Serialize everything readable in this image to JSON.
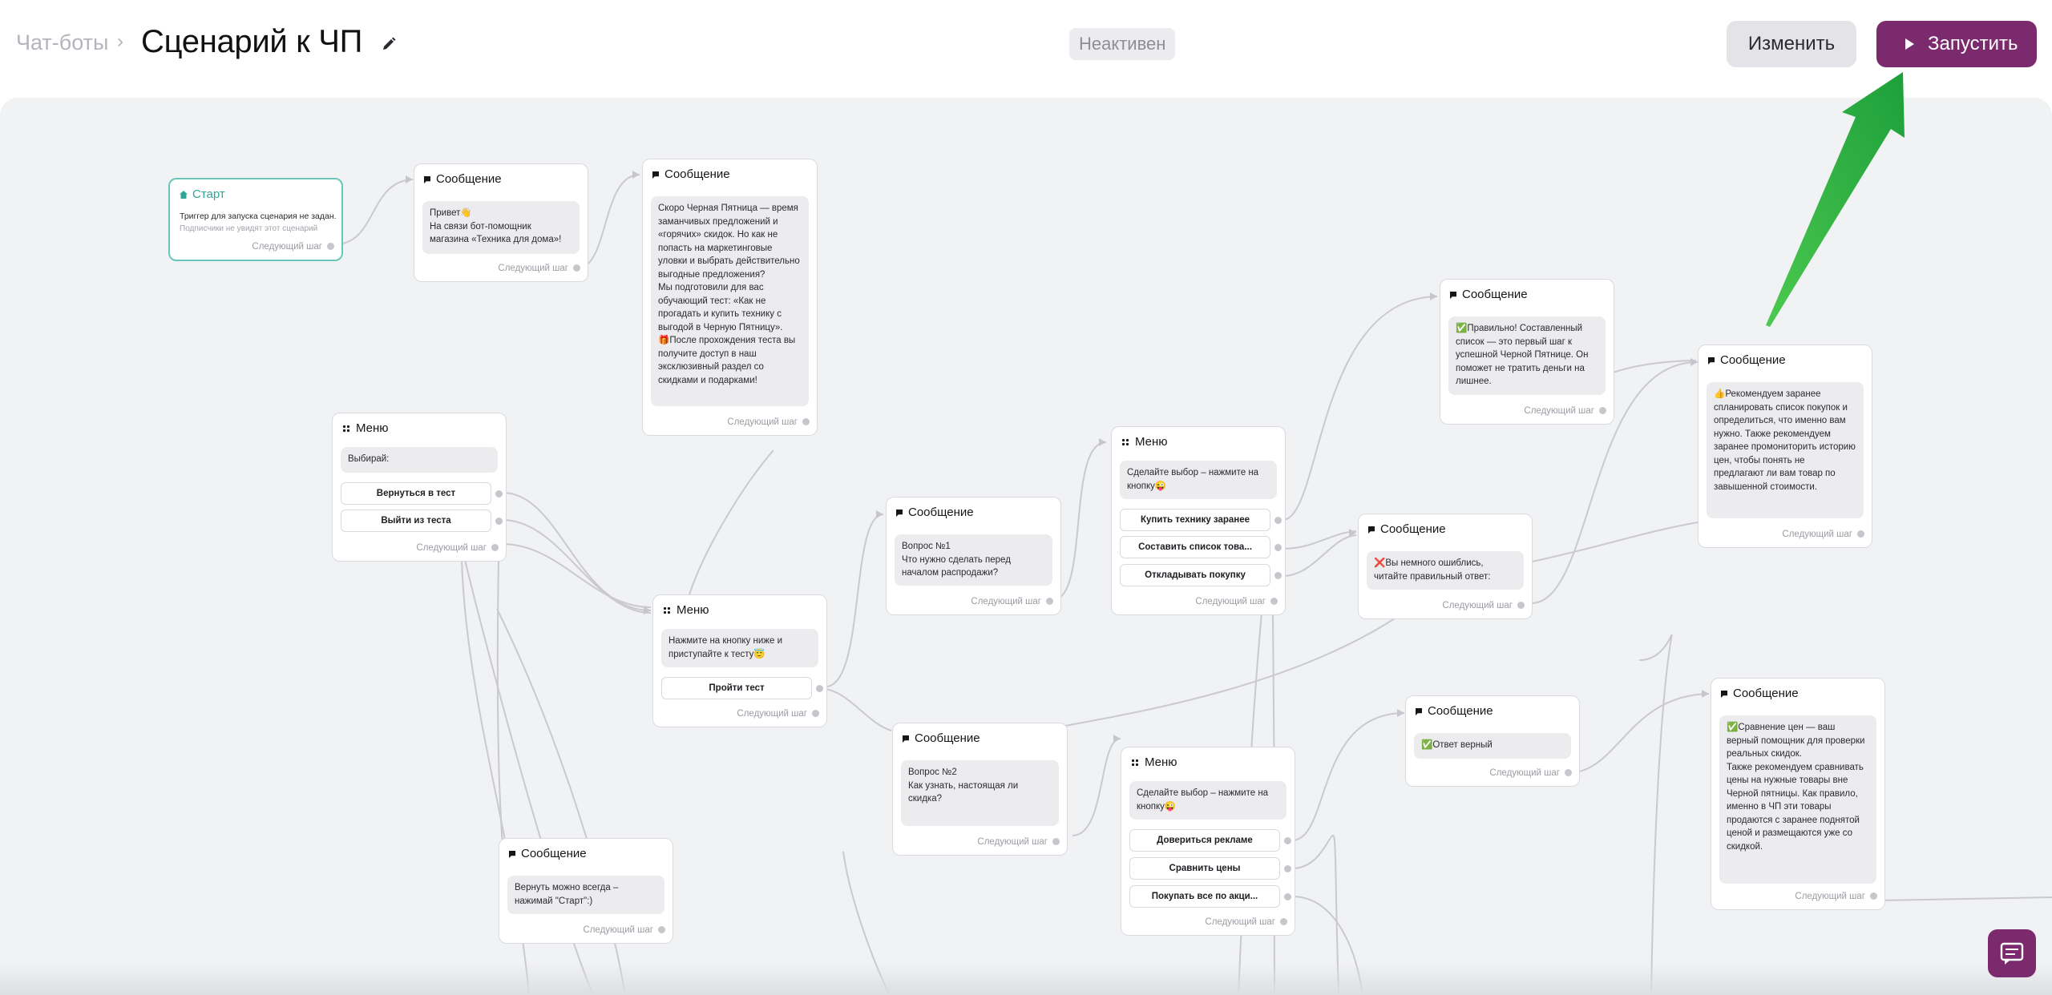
{
  "header": {
    "breadcrumb_root": "Чат-боты",
    "breadcrumb_sep": "›",
    "title": "Сценарий к ЧП",
    "status": "Неактивен",
    "edit_label": "Изменить",
    "run_label": "Запустить"
  },
  "common": {
    "next_step": "Следующий шаг"
  },
  "nodes": {
    "start": {
      "title": "Старт",
      "hint": "Триггер для запуска сценария не задан.",
      "sub": "Подписчики не увидят этот сценарий"
    },
    "msg1": {
      "title": "Сообщение",
      "text": "Привет👋\nНа связи бот-помощник магазина «Техника для дома»!"
    },
    "msg2": {
      "title": "Сообщение",
      "text": "Скоро Черная Пятница — время заманчивых предложений и «горячих» скидок. Но как не попасть на маркетинговые уловки и выбрать действительно выгодные предложения?\nМы подготовили для вас обучающий тест: «Как не прогадать и купить технику с выгодой в Черную Пятницу».\n🎁После прохождения теста вы получите доступ в наш эксклюзивный раздел со скидками и подарками!"
    },
    "menu1": {
      "title": "Меню",
      "text": "Выбирай:",
      "buttons": [
        "Вернуться в тест",
        "Выйти из теста"
      ]
    },
    "menu2": {
      "title": "Меню",
      "text": "Нажмите на кнопку ниже и приступайте к тесту😇",
      "buttons": [
        "Пройти тест"
      ]
    },
    "q1": {
      "title": "Сообщение",
      "text": "Вопрос №1\nЧто нужно сделать перед началом распродажи?"
    },
    "menu3": {
      "title": "Меню",
      "text": "Сделайте выбор – нажмите на кнопку😜",
      "buttons": [
        "Купить технику заранее",
        "Составить список това...",
        "Откладывать покупку"
      ]
    },
    "correct1": {
      "title": "Сообщение",
      "text": "✅Правильно! Составленный список — это первый шаг к успешной Черной Пятнице. Он поможет не тратить деньги на лишнее."
    },
    "wrong1": {
      "title": "Сообщение",
      "text": "❌Вы немного ошиблись, читайте правильный ответ:"
    },
    "rec1": {
      "title": "Сообщение",
      "text": "👍Рекомендуем заранее спланировать список покупок и определиться, что именно вам нужно. Также рекомендуем заранее промониторить историю цен, чтобы понять не предлагают ли вам товар по завышенной стоимости."
    },
    "msg_return": {
      "title": "Сообщение",
      "text": "Вернуть можно всегда – нажимай \"Старт\":)"
    },
    "q2": {
      "title": "Сообщение",
      "text": "Вопрос №2\nКак узнать, настоящая ли скидка?"
    },
    "menu4": {
      "title": "Меню",
      "text": "Сделайте выбор – нажмите на кнопку😜",
      "buttons": [
        "Довериться рекламе",
        "Сравнить цены",
        "Покупать все по акци..."
      ]
    },
    "correct2": {
      "title": "Сообщение",
      "text": "✅Ответ верный"
    },
    "rec2": {
      "title": "Сообщение",
      "text": "✅Сравнение цен — ваш верный помощник для проверки реальных скидок.\nТакже рекомендуем сравнивать цены на нужные товары вне Черной пятницы. Как правило, именно в ЧП эти товары продаются с заранее поднятой ценой и размещаются уже со скидкой."
    }
  },
  "colors": {
    "accent": "#7c2a6e",
    "start_border": "#6bc6b9",
    "arrow": "#2db34a",
    "canvas": "#f1f2f4"
  },
  "icons": {
    "edit": "pencil-icon",
    "run": "play-icon",
    "message": "message-icon",
    "menu": "menu-grid-icon",
    "start": "home-icon",
    "chat": "chat-icon"
  }
}
